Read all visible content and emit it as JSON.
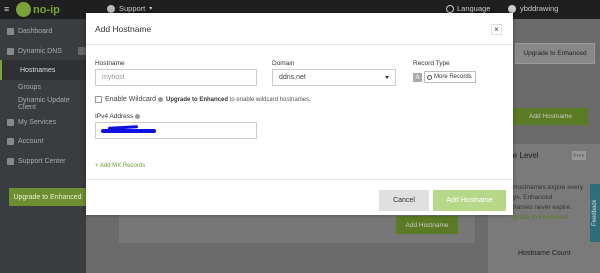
{
  "topbar": {
    "logo_text": "no-ip",
    "support_label": "Support",
    "language_label": "Language",
    "username": "ybddrawing"
  },
  "sidebar": {
    "items": [
      {
        "label": "Dashboard"
      },
      {
        "label": "Dynamic DNS"
      },
      {
        "label": "Hostnames"
      },
      {
        "label": "Groups"
      },
      {
        "label": "Dynamic Update Client"
      },
      {
        "label": "My Services"
      },
      {
        "label": "Account"
      },
      {
        "label": "Support Center"
      }
    ],
    "upgrade_label": "Upgrade to Enhanced"
  },
  "background": {
    "upgrade_label": "Upgrade to Enhanced",
    "add_hostname_label": "Add Hostname",
    "service_level_label": "ice Level",
    "free_badge": "Free",
    "expire_text_1": "Hostnames expire every",
    "expire_text_2": "ys. Enhanced",
    "expire_text_3": "hames never expire.",
    "upgrade_link": "grade to Enhanced",
    "add_hostname_label_2": "Add Hostname",
    "hostname_count_label": "Hostname Count",
    "feedback_label": "Feedback"
  },
  "modal": {
    "title": "Add Hostname",
    "close_label": "×",
    "hostname_label": "Hostname",
    "hostname_placeholder": "myhost",
    "domain_label": "Domain",
    "domain_value": "ddns.net",
    "record_type_label": "Record Type",
    "record_type_value": "A",
    "more_records_label": "More Records",
    "wildcard_label": "Enable Wildcard",
    "upgrade_bold": "Upgrade to Enhanced",
    "upgrade_text": " to enable wildcard hostnames.",
    "ipv4_label": "IPv4 Address",
    "mx_link": "+ Add MX Records",
    "cancel_label": "Cancel",
    "add_label": "Add Hostname"
  }
}
